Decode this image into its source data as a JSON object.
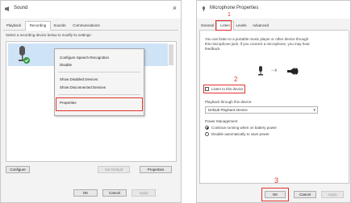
{
  "sound_dialog": {
    "title": "Sound",
    "close_glyph": "×",
    "tabs": [
      {
        "label": "Playback"
      },
      {
        "label": "Recording",
        "active": true
      },
      {
        "label": "Sounds"
      },
      {
        "label": "Communications"
      }
    ],
    "instruction": "Select a recording device below to modify its settings:",
    "context_menu": {
      "items": [
        {
          "label": "Configure Speech Recognition"
        },
        {
          "label": "Disable"
        },
        {
          "label": "Show Disabled Devices"
        },
        {
          "label": "Show Disconnected Devices"
        },
        {
          "label": "Properties",
          "highlighted": true
        }
      ]
    },
    "buttons": {
      "configure": "Configure",
      "set_default": "Set Default",
      "properties": "Properties",
      "ok": "OK",
      "cancel": "Cancel",
      "apply": "Apply"
    }
  },
  "mic_dialog": {
    "title": "Microphone Properties",
    "tabs": [
      {
        "label": "General"
      },
      {
        "label": "Listen",
        "active": true
      },
      {
        "label": "Levels"
      },
      {
        "label": "Advanced"
      }
    ],
    "description_line1": "You can listen to a portable music player or other device through",
    "description_line2": "this microphone jack. If you connect a microphone, you may hear",
    "description_line3": "feedback.",
    "arrow_glyph": "⇢",
    "listen_checkbox_label": "Listen to this device",
    "playback_label": "Playback through this device:",
    "playback_value": "Default Playback Device",
    "power_title": "Power Management",
    "power_opt1": "Continue running when on battery power",
    "power_opt2": "Disable automatically to save power",
    "buttons": {
      "ok": "OK",
      "cancel": "Cancel",
      "apply": "Apply"
    }
  },
  "annotations": {
    "step1": "1",
    "step2": "2",
    "step3": "3"
  },
  "colors": {
    "highlight_red": "#e2332b",
    "device_green": "#2e9e3e",
    "selection_blue": "#cfe3f7"
  }
}
